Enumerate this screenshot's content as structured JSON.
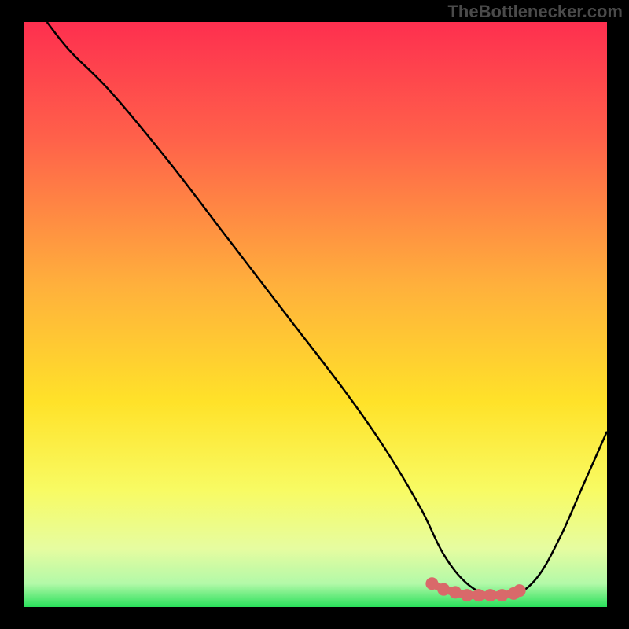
{
  "watermark": "TheBottlenecker.com",
  "colors": {
    "frame": "#000000",
    "curve": "#000000",
    "marker_fill": "#d9696a",
    "marker_stroke": "#d9696a",
    "gradient_stops": [
      {
        "offset": 0.0,
        "color": "#fe2f4f"
      },
      {
        "offset": 0.2,
        "color": "#ff614a"
      },
      {
        "offset": 0.45,
        "color": "#ffb03c"
      },
      {
        "offset": 0.65,
        "color": "#ffe229"
      },
      {
        "offset": 0.8,
        "color": "#f8fb63"
      },
      {
        "offset": 0.9,
        "color": "#e6fca0"
      },
      {
        "offset": 0.96,
        "color": "#b3f9a8"
      },
      {
        "offset": 1.0,
        "color": "#2ae05b"
      }
    ]
  },
  "chart_data": {
    "type": "line",
    "title": "",
    "xlabel": "",
    "ylabel": "",
    "xlim": [
      0,
      100
    ],
    "ylim": [
      0,
      100
    ],
    "grid": false,
    "legend": false,
    "x": [
      4,
      8,
      15,
      25,
      35,
      45,
      55,
      62,
      68,
      72,
      76,
      80,
      84,
      88,
      92,
      96,
      100
    ],
    "y": [
      100,
      95,
      88,
      76,
      63,
      50,
      37,
      27,
      17,
      9,
      4,
      2,
      2,
      5,
      12,
      21,
      30
    ],
    "optimal_zone": {
      "x_start": 70,
      "x_end": 85,
      "y": 2
    },
    "markers": {
      "x": [
        70,
        72,
        74,
        76,
        78,
        80,
        82,
        84,
        85
      ],
      "y": [
        4,
        3,
        2.5,
        2,
        2,
        2,
        2,
        2.3,
        2.8
      ]
    }
  }
}
